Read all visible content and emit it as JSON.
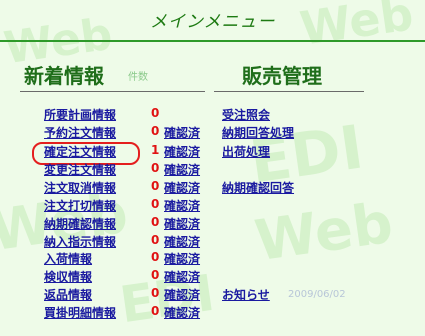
{
  "header": {
    "title": "メインメニュー"
  },
  "sections": {
    "left": {
      "title": "新着情報",
      "sub": "件数"
    },
    "right": {
      "title": "販売管理"
    }
  },
  "news": [
    {
      "label": "所要計画情報",
      "count": "0",
      "status": ""
    },
    {
      "label": "予約注文情報",
      "count": "0",
      "status": "確認済"
    },
    {
      "label": "確定注文情報",
      "count": "1",
      "status": "確認済"
    },
    {
      "label": "変更注文情報",
      "count": "0",
      "status": "確認済"
    },
    {
      "label": "注文取消情報",
      "count": "0",
      "status": "確認済"
    },
    {
      "label": "注文打切情報",
      "count": "0",
      "status": "確認済"
    },
    {
      "label": "納期確認情報",
      "count": "0",
      "status": "確認済"
    },
    {
      "label": "納入指示情報",
      "count": "0",
      "status": "確認済"
    },
    {
      "label": "入荷情報",
      "count": "0",
      "status": "確認済"
    },
    {
      "label": "検収情報",
      "count": "0",
      "status": "確認済"
    },
    {
      "label": "返品情報",
      "count": "0",
      "status": "確認済"
    },
    {
      "label": "買掛明細情報",
      "count": "0",
      "status": "確認済"
    }
  ],
  "sales": {
    "items": [
      "受注照会",
      "納期回答処理",
      "出荷処理",
      "納期確認回答"
    ],
    "notice": "お知らせ",
    "date": "2009/06/02"
  },
  "colors": {
    "link": "#1a1aa0",
    "count": "#e01212",
    "highlight": "#e41e1e",
    "accent": "#1d7a12"
  }
}
